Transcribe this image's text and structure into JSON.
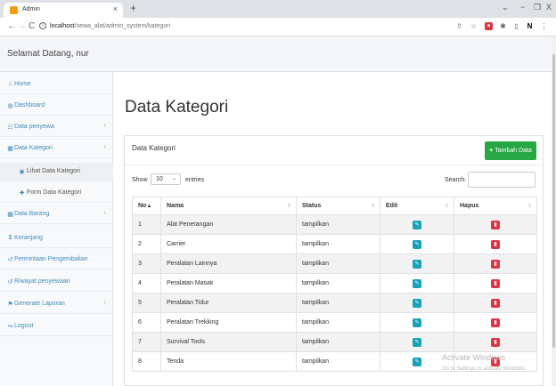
{
  "browser": {
    "tab_title": "Admin",
    "tab_close": "×",
    "new_tab": "+",
    "url_host": "localhost",
    "url_path": "/sewa_alat/admin_system/kategori",
    "back": "←",
    "forward": "→",
    "reload": "C",
    "info": "i",
    "minimize": "−",
    "maximize": "❐",
    "close": "X",
    "dropdown": "⌄"
  },
  "header": {
    "welcome": "Selamat Datang, nur"
  },
  "sidebar": {
    "items": [
      {
        "label": "Home",
        "icon": "home-icon"
      },
      {
        "label": "Dashboard",
        "icon": "dashboard-icon"
      },
      {
        "label": "Data penyewa",
        "icon": "users-icon",
        "chevron": "‹"
      },
      {
        "label": "Data Kategori",
        "icon": "table-icon",
        "chevron": "‹"
      },
      {
        "label": "Lihat Data Kategori",
        "icon": "eye-icon"
      },
      {
        "label": "Form Data Kategori",
        "icon": "plus-icon"
      },
      {
        "label": "Data Barang",
        "icon": "table-icon",
        "chevron": "‹"
      },
      {
        "label": "Keranjang",
        "icon": "dollar-icon"
      },
      {
        "label": "Permintaan Pengembalian",
        "icon": "history-icon"
      },
      {
        "label": "Riwayat penyewaan",
        "icon": "history-icon"
      },
      {
        "label": "Generate Laporan",
        "icon": "flag-icon",
        "chevron": "‹"
      },
      {
        "label": "Logout",
        "icon": "logout-icon"
      }
    ]
  },
  "main": {
    "page_title": "Data Kategori",
    "card_title": "Data Kategori",
    "add_button": "Tambah Data",
    "show_label": "Show",
    "entries_value": "10",
    "entries_label": "entries",
    "search_label": "Search:",
    "columns": [
      "No",
      "Nama",
      "Status",
      "Edit",
      "Hapus"
    ],
    "rows": [
      {
        "no": "1",
        "nama": "Alat Penerangan",
        "status": "tampilkan"
      },
      {
        "no": "2",
        "nama": "Carrier",
        "status": "tampilkan"
      },
      {
        "no": "3",
        "nama": "Peralatan Lainnya",
        "status": "tampilkan"
      },
      {
        "no": "4",
        "nama": "Peralatan Masak",
        "status": "tampilkan"
      },
      {
        "no": "5",
        "nama": "Peralatan Tidur",
        "status": "tampilkan"
      },
      {
        "no": "6",
        "nama": "Peralatan Trekking",
        "status": "tampilkan"
      },
      {
        "no": "7",
        "nama": "Survival Tools",
        "status": "tampilkan"
      },
      {
        "no": "8",
        "nama": "Tenda",
        "status": "tampilkan"
      }
    ]
  },
  "watermark": {
    "line1": "Activate Windows",
    "line2": "Go to Settings to activate Windows."
  },
  "colors": {
    "accent": "#3c8dbc",
    "success": "#28a745",
    "info": "#17a2b8",
    "danger": "#dc3545"
  }
}
